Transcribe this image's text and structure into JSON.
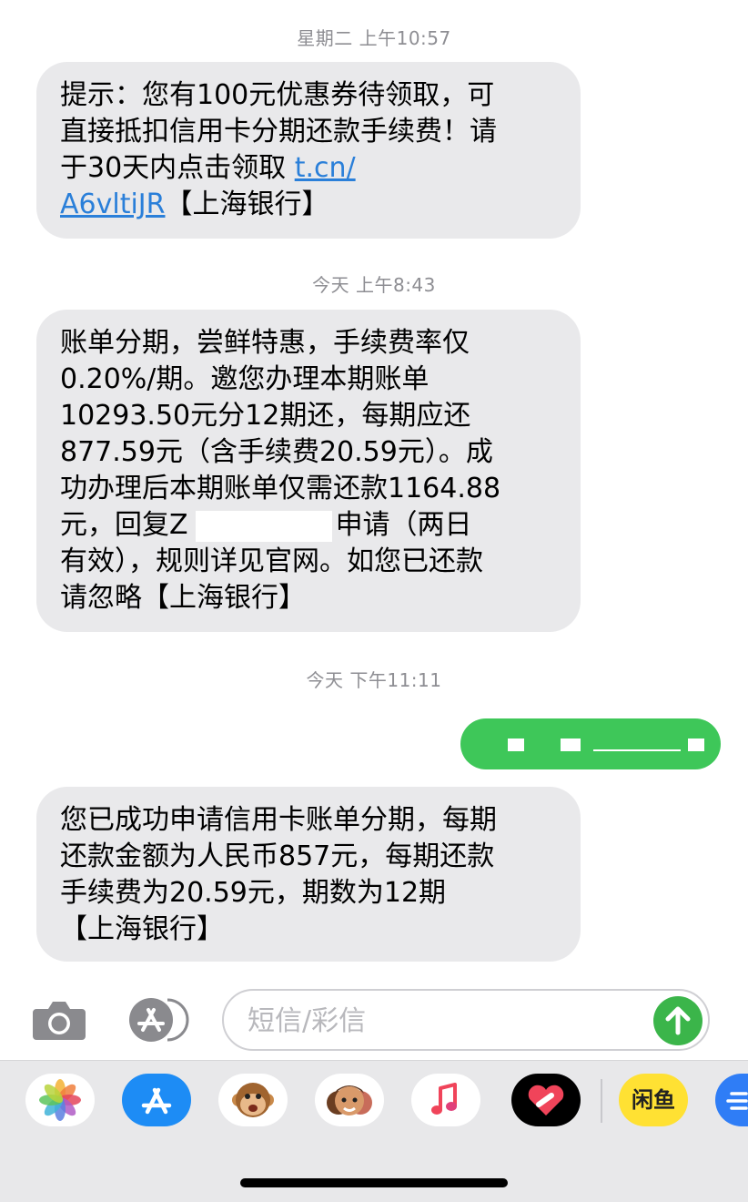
{
  "thread": {
    "timestamps": [
      "星期二 上午10:57",
      "今天 上午8:43",
      "今天 下午11:11"
    ],
    "messages": [
      {
        "lines": [
          "提示：您有100元优惠券待领取，可",
          "直接抵扣信用卡分期还款手续费！请",
          "于30天内点击领取 ",
          "A6vltiJR",
          "【上海银行】"
        ],
        "link_part1": "t.cn/",
        "link_part2": "A6vltiJR"
      },
      {
        "lines": [
          "账单分期，尝鲜特惠，手续费率仅",
          "0.20%/期。邀您办理本期账单",
          "10293.50元分12期还，每期应还",
          "877.59元（含手续费20.59元）。成",
          "功办理后本期账单仅需还款1164.88",
          "元，回复Z",
          "申请（两日",
          "有效），规则详见官网。如您已还款",
          "请忽略【上海银行】"
        ]
      },
      {
        "lines": [
          "您已成功申请信用卡账单分期，每期",
          "还款金额为人民币857元，每期还款",
          "手续费为20.59元，期数为12期",
          "【上海银行】"
        ]
      }
    ]
  },
  "compose": {
    "placeholder": "短信/彩信"
  },
  "drawer": {
    "apps": [
      "photos-icon",
      "app-store-icon",
      "animoji-icon",
      "memoji-icon",
      "music-icon",
      "digital-touch-icon",
      "xianyu-icon",
      "more-app-icon"
    ],
    "xianyu_label": "闲鱼"
  },
  "colors": {
    "received_bubble": "#e9e9eb",
    "sent_bubble": "#3ec759",
    "link": "#2a7fd9",
    "send_button": "#3bb54a"
  }
}
